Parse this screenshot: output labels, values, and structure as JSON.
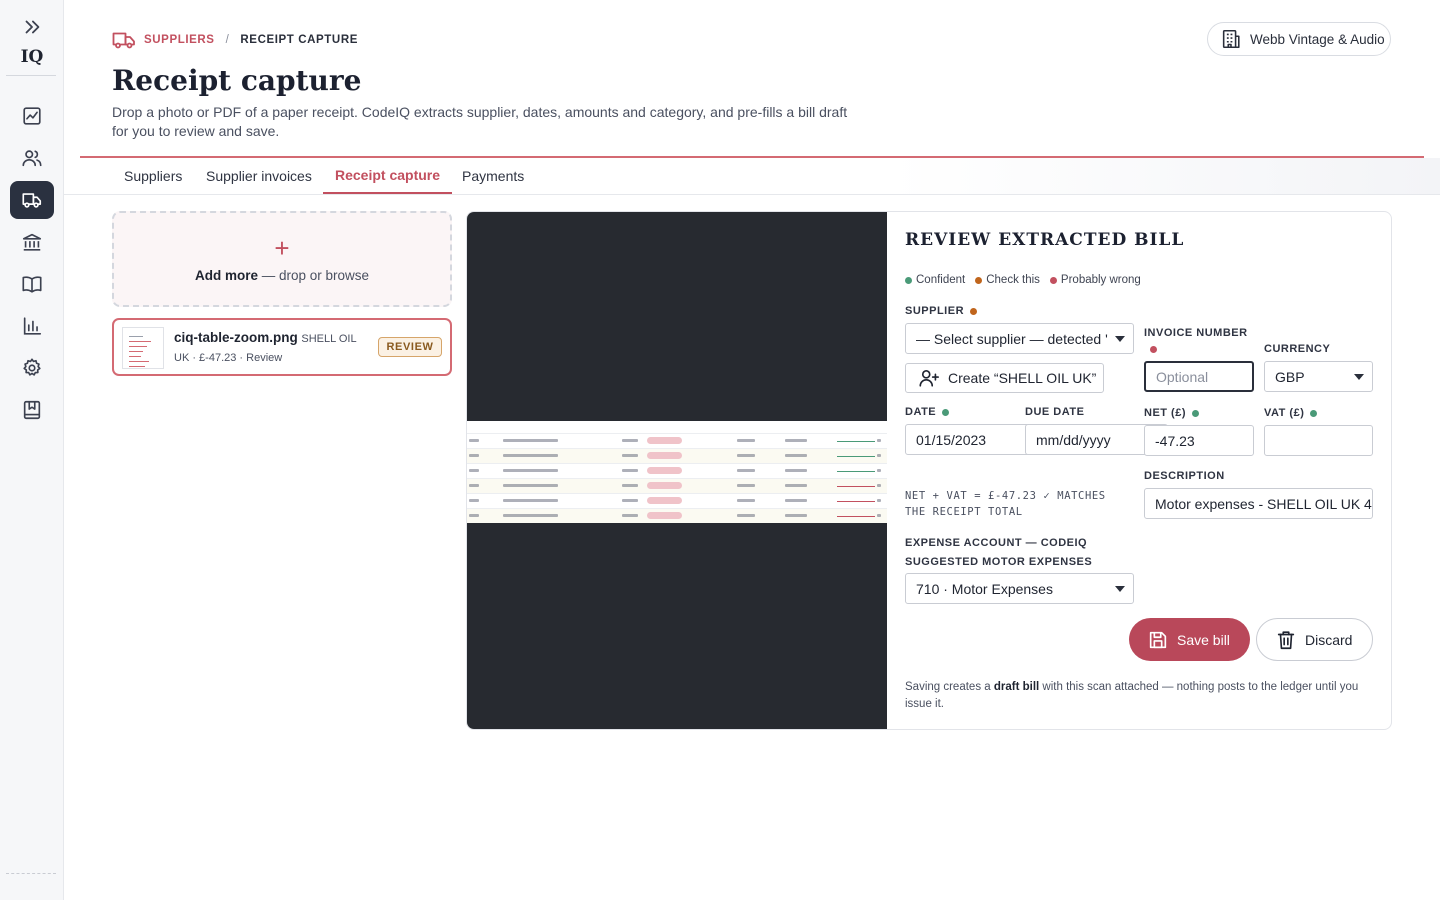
{
  "sidebar": {
    "expand_icon": "chevrons-right-icon",
    "logo": "IQ",
    "items": [
      {
        "name": "dashboard",
        "icon": "chart-board-icon"
      },
      {
        "name": "customers",
        "icon": "users-icon"
      },
      {
        "name": "suppliers",
        "icon": "truck-icon",
        "active": true
      },
      {
        "name": "banking",
        "icon": "bank-icon"
      },
      {
        "name": "ledger",
        "icon": "book-icon"
      },
      {
        "name": "reports",
        "icon": "bar-chart-icon"
      },
      {
        "name": "settings",
        "icon": "gear-icon"
      },
      {
        "name": "guide",
        "icon": "bookmark-book-icon"
      }
    ]
  },
  "header": {
    "breadcrumb": {
      "parent": "SUPPLIERS",
      "separator": "/",
      "current": "RECEIPT CAPTURE"
    },
    "title": "Receipt capture",
    "subtitle": "Drop a photo or PDF of a paper receipt. CodeIQ extracts supplier, dates, amounts and category, and pre-fills a bill draft for you to review and save.",
    "org_name": "Webb Vintage & Audio"
  },
  "tabs": [
    {
      "label": "Suppliers",
      "active": false
    },
    {
      "label": "Supplier invoices",
      "active": false
    },
    {
      "label": "Receipt capture",
      "active": true
    },
    {
      "label": "Payments",
      "active": false
    }
  ],
  "dropzone": {
    "plus": "+",
    "strong": "Add more",
    "rest": " — drop or browse"
  },
  "receipt": {
    "filename": "ciq-table-zoom.png",
    "supplier": "SHELL OIL UK",
    "meta": " · £-47.23 · Review",
    "badge": "REVIEW"
  },
  "review": {
    "title": "REVIEW EXTRACTED BILL",
    "legend": [
      {
        "label": "Confident",
        "color": "#4a9a78"
      },
      {
        "label": "Check this",
        "color": "#c0651c"
      },
      {
        "label": "Probably wrong",
        "color": "#c2505f"
      }
    ],
    "supplier_label": "SUPPLIER",
    "supplier_value": "— Select supplier — detected '",
    "create_label": "Create “SHELL OIL UK”",
    "invoice_label": "INVOICE NUMBER",
    "invoice_placeholder": "Optional",
    "currency_label": "CURRENCY",
    "currency_value": "GBP",
    "date_label": "DATE",
    "date_value": "01/15/2023",
    "due_label": "DUE DATE",
    "due_placeholder": "mm/dd/yyyy",
    "net_label": "NET (£)",
    "net_value": "-47.23",
    "vat_label": "VAT (£)",
    "vat_value": "",
    "matches_line1": "NET + VAT = £-47.23 ✓ MATCHES",
    "matches_line2": "THE RECEIPT TOTAL",
    "description_label": "DESCRIPTION",
    "description_value": "Motor expenses - SHELL OIL UK 4",
    "expense_label_1": "EXPENSE ACCOUNT — CODEIQ",
    "expense_label_2": "SUGGESTED MOTOR EXPENSES",
    "expense_value": "710 · Motor Expenses",
    "save_label": "Save bill",
    "discard_label": "Discard",
    "footnote_pre": "Saving creates a ",
    "footnote_bold": "draft bill",
    "footnote_post": " with this scan attached — nothing posts to the ledger until you issue it."
  },
  "colors": {
    "accent": "#c2505f",
    "sidebar_active": "#2a3140",
    "confident": "#4a9a78",
    "check": "#c0651c",
    "wrong": "#c2505f"
  }
}
